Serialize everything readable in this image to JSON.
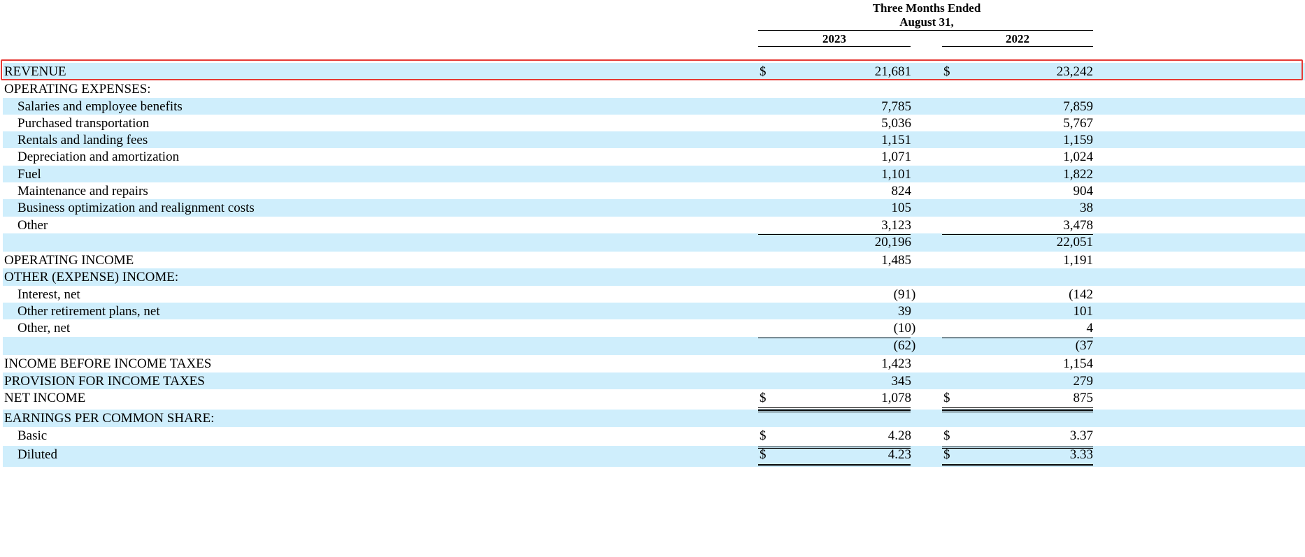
{
  "header": {
    "period_line1": "Three Months Ended",
    "period_line2": "August 31,",
    "col1_year": "2023",
    "col2_year": "2022"
  },
  "rows": [
    {
      "label": "REVENUE",
      "indent": 0,
      "dollar1": "$",
      "v1": "21,681",
      "dollar2": "$",
      "v2": "23,242",
      "highlighted": true
    },
    {
      "label": "OPERATING EXPENSES:",
      "indent": 0
    },
    {
      "label": "Salaries and employee benefits",
      "indent": 1,
      "v1": "7,785",
      "v2": "7,859"
    },
    {
      "label": "Purchased transportation",
      "indent": 1,
      "v1": "5,036",
      "v2": "5,767"
    },
    {
      "label": "Rentals and landing fees",
      "indent": 1,
      "v1": "1,151",
      "v2": "1,159"
    },
    {
      "label": "Depreciation and amortization",
      "indent": 1,
      "v1": "1,071",
      "v2": "1,024"
    },
    {
      "label": "Fuel",
      "indent": 1,
      "v1": "1,101",
      "v2": "1,822"
    },
    {
      "label": "Maintenance and repairs",
      "indent": 1,
      "v1": "824",
      "v2": "904"
    },
    {
      "label": "Business optimization and realignment costs",
      "indent": 1,
      "v1": "105",
      "v2": "38"
    },
    {
      "label": "Other",
      "indent": 1,
      "v1": "3,123",
      "v2": "3,478"
    },
    {
      "label": "",
      "indent": 0,
      "v1": "20,196",
      "v2": "22,051"
    },
    {
      "label": "OPERATING INCOME",
      "indent": 0,
      "v1": "1,485",
      "v2": "1,191"
    },
    {
      "label": "OTHER (EXPENSE) INCOME:",
      "indent": 0
    },
    {
      "label": "Interest, net",
      "indent": 1,
      "v1": "(91",
      "p1": ")",
      "v2": "(142"
    },
    {
      "label": "Other retirement plans, net",
      "indent": 1,
      "v1": "39",
      "v2": "101"
    },
    {
      "label": "Other, net",
      "indent": 1,
      "v1": "(10",
      "p1": ")",
      "v2": "4"
    },
    {
      "label": "",
      "indent": 0,
      "v1": "(62",
      "p1": ")",
      "v2": "(37"
    },
    {
      "label": "INCOME BEFORE INCOME TAXES",
      "indent": 0,
      "v1": "1,423",
      "v2": "1,154"
    },
    {
      "label": "PROVISION FOR INCOME TAXES",
      "indent": 0,
      "v1": "345",
      "v2": "279"
    },
    {
      "label": "NET INCOME",
      "indent": 0,
      "dollar1": "$",
      "v1": "1,078",
      "dollar2": "$",
      "v2": "875"
    },
    {
      "label": "EARNINGS PER COMMON SHARE:",
      "indent": 0
    },
    {
      "label": "Basic",
      "indent": 1,
      "dollar1": "$",
      "v1": "4.28",
      "dollar2": "$",
      "v2": "3.37"
    },
    {
      "label": "Diluted",
      "indent": 1,
      "dollar1": "$",
      "v1": "4.23",
      "dollar2": "$",
      "v2": "3.33"
    }
  ]
}
